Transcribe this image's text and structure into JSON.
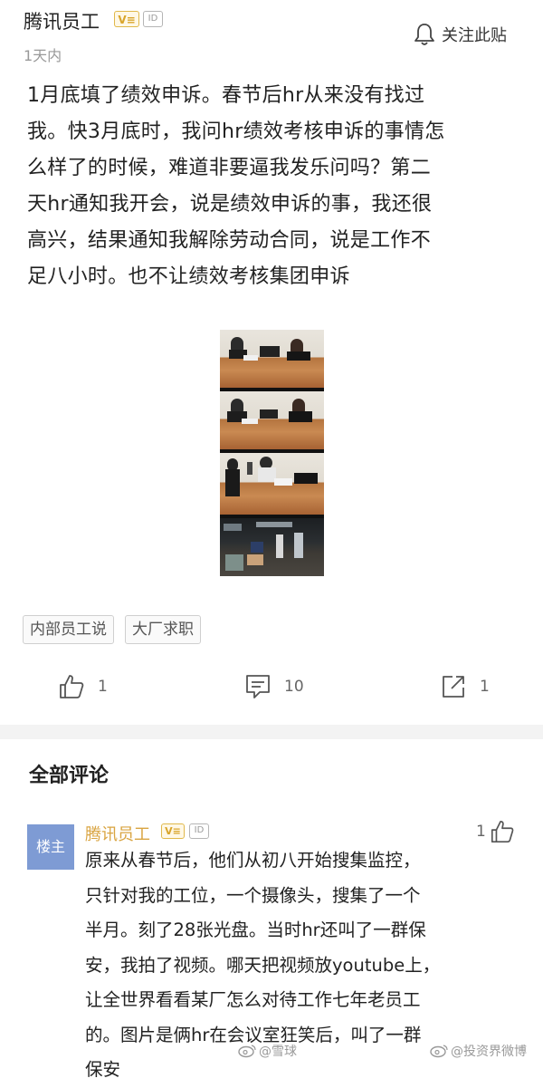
{
  "post": {
    "author": "腾讯员工",
    "badge_v": "V≡",
    "badge_id": "ID",
    "time": "1天内",
    "follow_label": "关注此贴",
    "lines": [
      "1月底填了绩效申诉。春节后hr从来没有找过",
      "我。快3月底时，我问hr绩效考核申诉的事情怎",
      "么样了的时候，难道非要逼我发乐问吗？第二",
      "天hr通知我开会，说是绩效申诉的事，我还很",
      "高兴，结果通知我解除劳动合同，说是工作不",
      "足八小时。也不让绩效考核集团申诉"
    ],
    "tags": [
      "内部员工说",
      "大厂求职"
    ],
    "likes": "1",
    "comments": "10",
    "shares": "1"
  },
  "comments_section": {
    "title": "全部评论",
    "items": [
      {
        "avatar_text": "楼主",
        "author": "腾讯员工",
        "badge_v": "V≡",
        "badge_id": "ID",
        "likes": "1",
        "lines": [
          "原来从春节后，他们从初八开始搜集监控，",
          "只针对我的工位，一个摄像头，搜集了一个",
          "半月。刻了28张光盘。当时hr还叫了一群保",
          "安，我拍了视频。哪天把视频放youtube上，",
          "让全世界看看某厂怎么对待工作七年老员工",
          "的。图片是俩hr在会议室狂笑后，叫了一群",
          "保安"
        ]
      }
    ]
  },
  "watermarks": [
    "@雪球",
    "@投资界微博"
  ],
  "colors": {
    "author_gold": "#d9a441",
    "avatar_blue": "#7e9bd4",
    "muted_text": "#999999",
    "divider": "#f3f3f3"
  },
  "icons": [
    "bell-icon",
    "thumbs-up-icon",
    "comment-icon",
    "share-icon"
  ]
}
